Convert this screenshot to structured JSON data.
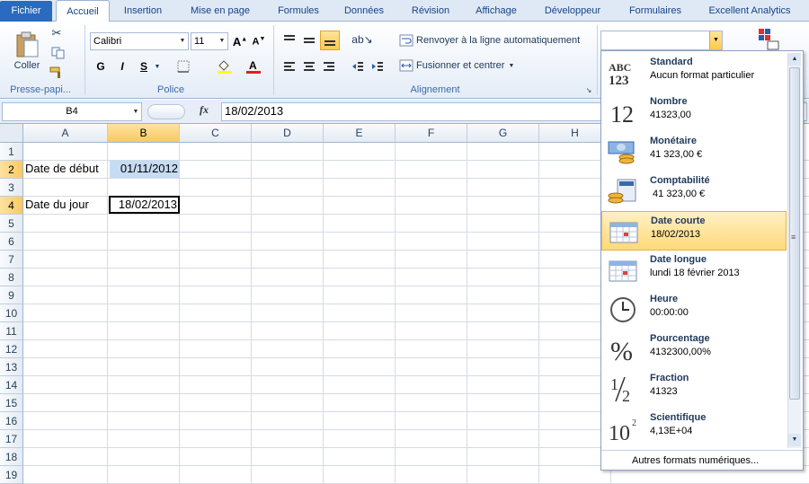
{
  "tabs": [
    "Fichier",
    "Accueil",
    "Insertion",
    "Mise en page",
    "Formules",
    "Données",
    "Révision",
    "Affichage",
    "Développeur",
    "Formulaires",
    "Excellent Analytics"
  ],
  "ribbon": {
    "paste_label": "Coller",
    "clipboard_group": "Presse-papi...",
    "font_name": "Calibri",
    "font_size": "11",
    "font_group": "Police",
    "bold": "G",
    "italic": "I",
    "underline": "S",
    "wrap_text": "Renvoyer à la ligne automatiquement",
    "merge_center": "Fusionner et centrer",
    "alignment_group": "Alignement"
  },
  "formula_bar": {
    "name_box": "B4",
    "fx": "fx",
    "value": "18/02/2013"
  },
  "grid": {
    "columns": [
      "A",
      "B",
      "C",
      "D",
      "E",
      "F",
      "G",
      "H"
    ],
    "rows": [
      "1",
      "2",
      "3",
      "4",
      "5",
      "6",
      "7",
      "8",
      "9",
      "10",
      "11",
      "12",
      "13",
      "14",
      "15",
      "16",
      "17",
      "18",
      "19"
    ],
    "cells": {
      "A2": "Date de début",
      "B2": "01/11/2012",
      "A4": "Date du jour",
      "B4": "18/02/2013"
    }
  },
  "number_format_menu": {
    "items": [
      {
        "title": "Standard",
        "sub": "Aucun format particulier",
        "icon": "abc-123-icon"
      },
      {
        "title": "Nombre",
        "sub": "41323,00",
        "icon": "number-12-icon"
      },
      {
        "title": "Monétaire",
        "sub": "41 323,00 €",
        "icon": "currency-icon"
      },
      {
        "title": "Comptabilité",
        "sub": " 41 323,00 €",
        "icon": "accounting-icon"
      },
      {
        "title": "Date courte",
        "sub": "18/02/2013",
        "icon": "calendar-icon"
      },
      {
        "title": "Date longue",
        "sub": "lundi 18 février 2013",
        "icon": "calendar-icon"
      },
      {
        "title": "Heure",
        "sub": "00:00:00",
        "icon": "clock-icon"
      },
      {
        "title": "Pourcentage",
        "sub": "4132300,00%",
        "icon": "percent-icon"
      },
      {
        "title": "Fraction",
        "sub": "41323",
        "icon": "fraction-icon"
      },
      {
        "title": "Scientifique",
        "sub": "4,13E+04",
        "icon": "scientific-icon"
      }
    ],
    "more_formats": "Autres formats numériques..."
  },
  "colors": {
    "file_tab": "#2a6bbf",
    "selected_cell_fill": "#c6dcf4",
    "highlight": "#ffd97a"
  }
}
